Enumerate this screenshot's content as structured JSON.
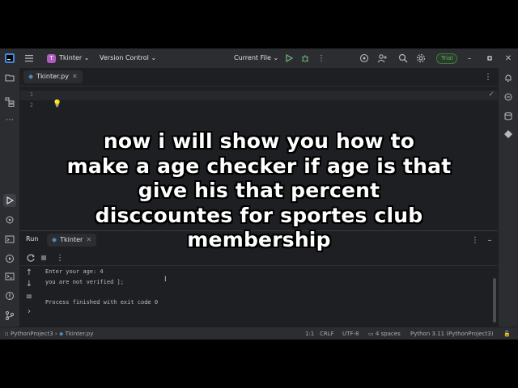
{
  "titlebar": {
    "project_badge": "T",
    "project_name": "Tkinter",
    "vcs_label": "Version Control",
    "run_config": "Current File",
    "trial_label": "Trial"
  },
  "editor": {
    "tab_label": "Tkinter.py",
    "line_numbers": [
      "1",
      "2"
    ]
  },
  "run_panel": {
    "title": "Run",
    "tab_label": "Tkinter",
    "console_lines": [
      "Enter your age: 4",
      "you are not verified ];",
      "",
      "Process finished with exit code 0"
    ]
  },
  "statusbar": {
    "project": "PythonProject3",
    "file": "Tkinter.py",
    "position": "1:1",
    "line_ending": "CRLF",
    "encoding": "UTF-8",
    "indent": "4 spaces",
    "interpreter": "Python 3.11 (PythonProject3)"
  },
  "overlay": {
    "lines": [
      "now i will show you how to",
      "make a age checker if age is that",
      "give his that percent",
      "disccountes for sportes club",
      "membership"
    ]
  },
  "colors": {
    "accent_green": "#6aab73",
    "project_badge": "#b05bbf",
    "background": "#1e1f22"
  }
}
